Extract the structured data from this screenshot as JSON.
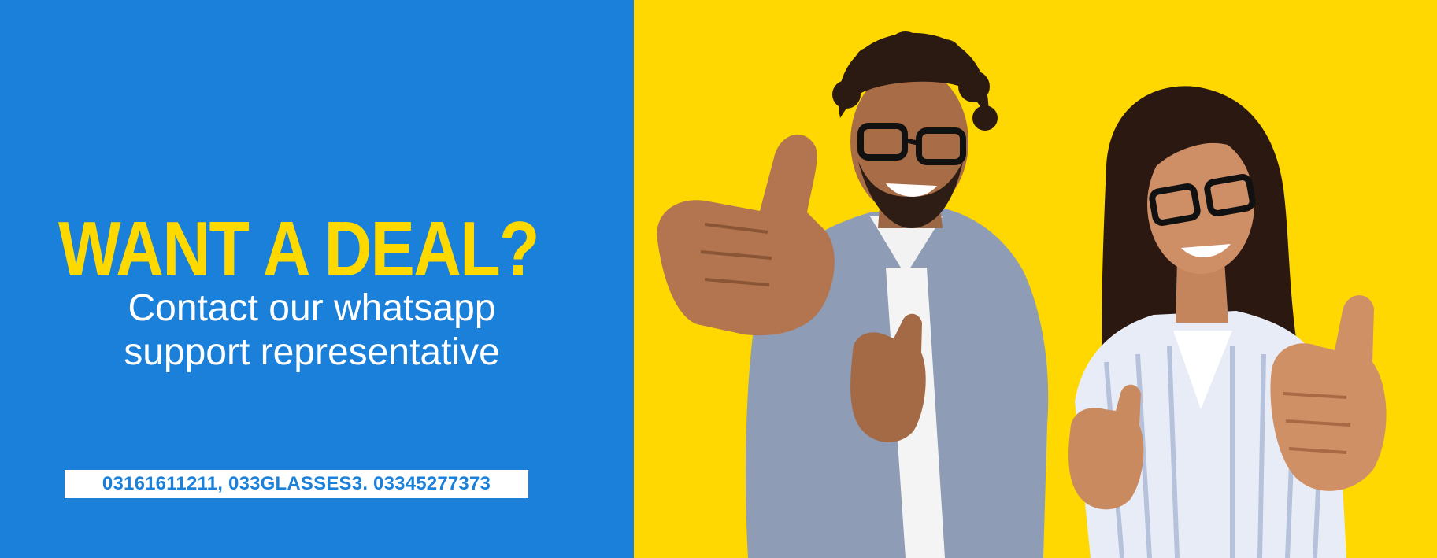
{
  "banner": {
    "headline": "WANT A DEAL?",
    "subtext_line1": "Contact our whatsapp",
    "subtext_line2": "support representative",
    "phone_numbers": "03161611211, 033GLASSES3. 03345277373"
  },
  "photo": {
    "description_icon": "people-thumbs-up-photo"
  },
  "colors": {
    "blue": "#1b80da",
    "yellow": "#fed800",
    "white": "#ffffff"
  }
}
